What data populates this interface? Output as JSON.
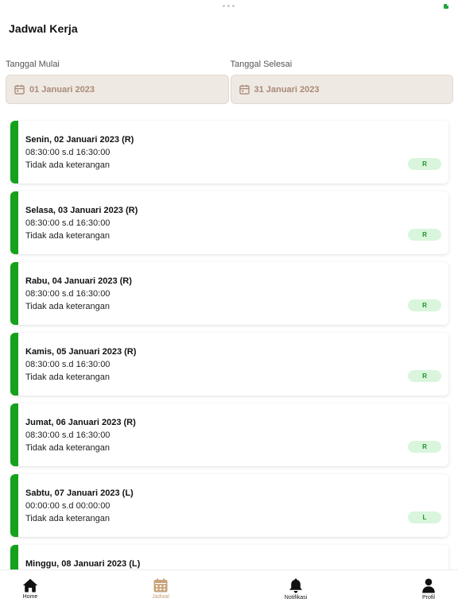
{
  "header": {
    "title": "Jadwal Kerja"
  },
  "filters": {
    "start": {
      "label": "Tanggal Mulai",
      "value": "01 Januari 2023"
    },
    "end": {
      "label": "Tanggal Selesai",
      "value": "31 Januari 2023"
    }
  },
  "schedules": [
    {
      "day": "Senin, 02 Januari 2023 (R)",
      "time": "08:30:00 s.d 16:30:00",
      "note": "Tidak ada keterangan",
      "badge": "R"
    },
    {
      "day": "Selasa, 03 Januari 2023 (R)",
      "time": "08:30:00 s.d 16:30:00",
      "note": "Tidak ada keterangan",
      "badge": "R"
    },
    {
      "day": "Rabu, 04 Januari 2023 (R)",
      "time": "08:30:00 s.d 16:30:00",
      "note": "Tidak ada keterangan",
      "badge": "R"
    },
    {
      "day": "Kamis, 05 Januari 2023 (R)",
      "time": "08:30:00 s.d 16:30:00",
      "note": "Tidak ada keterangan",
      "badge": "R"
    },
    {
      "day": "Jumat, 06 Januari 2023 (R)",
      "time": "08:30:00 s.d 16:30:00",
      "note": "Tidak ada keterangan",
      "badge": "R"
    },
    {
      "day": "Sabtu, 07 Januari 2023 (L)",
      "time": "00:00:00 s.d 00:00:00",
      "note": "Tidak ada keterangan",
      "badge": "L"
    },
    {
      "day": "Minggu, 08 Januari 2023 (L)",
      "time": "",
      "note": "",
      "badge": ""
    }
  ],
  "nav": {
    "home": {
      "label": "Home",
      "icon": "home-icon"
    },
    "jadwal": {
      "label": "Jadwal",
      "icon": "calendar-icon"
    },
    "notifikasi": {
      "label": "Notifikasi",
      "icon": "bell-icon"
    },
    "profil": {
      "label": "Profil",
      "icon": "user-icon"
    }
  },
  "colors": {
    "accent": "#c8a27a",
    "card_bar": "#15a11c",
    "badge_bg": "#d9f6dc",
    "badge_text": "#1f8f2b",
    "date_box_bg": "#efe9e3",
    "date_text": "#a98a77"
  }
}
